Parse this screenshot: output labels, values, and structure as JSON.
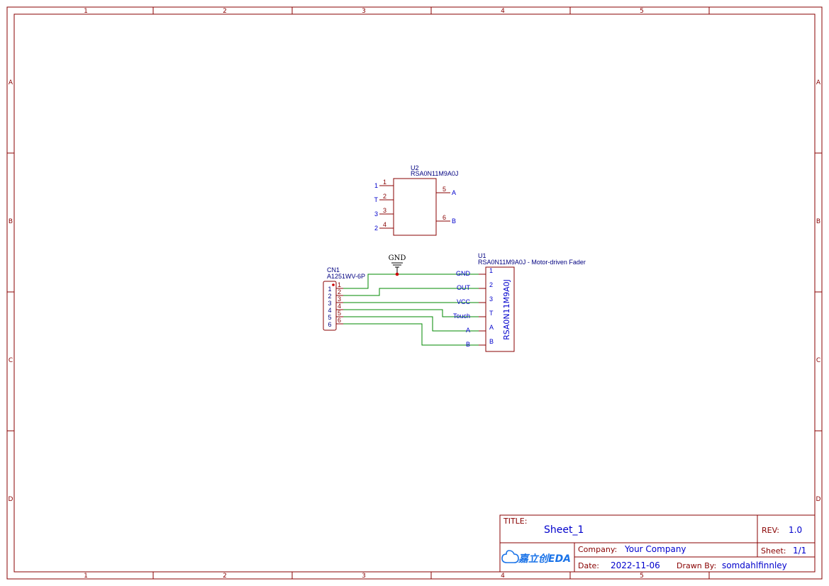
{
  "frame": {
    "columns": [
      "1",
      "2",
      "3",
      "4",
      "5"
    ],
    "rows": [
      "A",
      "B",
      "C",
      "D"
    ]
  },
  "title_block": {
    "title_label": "TITLE:",
    "title_value": "Sheet_1",
    "rev_label": "REV:",
    "rev_value": "1.0",
    "company_label": "Company:",
    "company_value": "Your Company",
    "sheet_label": "Sheet:",
    "sheet_value": "1/1",
    "date_label": "Date:",
    "date_value": "2022-11-06",
    "drawn_by_label": "Drawn By:",
    "drawn_by_value": "somdahlfinnley",
    "logo_text": "嘉立创EDA"
  },
  "u2": {
    "designator": "U2",
    "value": "RSA0N11M9A0J",
    "left_pins": [
      {
        "number": "1",
        "net": "1"
      },
      {
        "number": "2",
        "net": "T"
      },
      {
        "number": "3",
        "net": "3"
      },
      {
        "number": "4",
        "net": "2"
      }
    ],
    "right_pins": [
      {
        "number": "5",
        "net": "A"
      },
      {
        "number": "6",
        "net": "B"
      }
    ]
  },
  "gnd": {
    "label": "GND"
  },
  "cn1": {
    "designator": "CN1",
    "value": "A1251WV-6P",
    "pin_labels": [
      "1",
      "2",
      "3",
      "4",
      "5",
      "6"
    ],
    "pin_numbers": [
      "1",
      "2",
      "3",
      "4",
      "5",
      "6"
    ]
  },
  "u1": {
    "designator": "U1",
    "value": "RSA0N11M9A0J - Motor-driven Fader",
    "body_text": "RSA0N11M9A0J",
    "pin_labels": [
      "1",
      "2",
      "3",
      "T",
      "A",
      "B"
    ],
    "net_labels": [
      "GND",
      "OUT",
      "VCC",
      "Touch",
      "A",
      "B"
    ]
  },
  "colors": {
    "frame": "#880000",
    "wire": "#008800",
    "text": "#0000cc"
  }
}
